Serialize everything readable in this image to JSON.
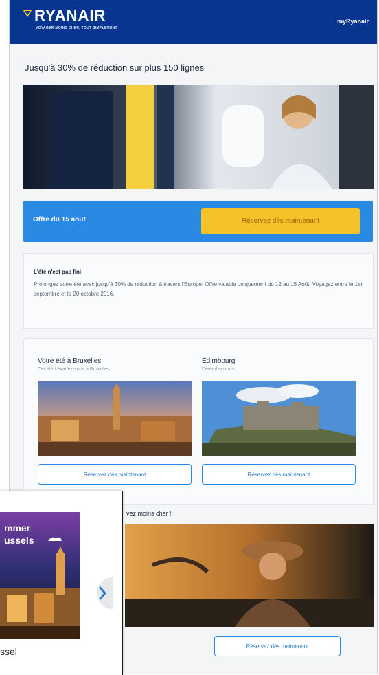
{
  "header": {
    "brand": "RYANAIR",
    "tagline": "VOYAGER MOINS CHER, TOUT SIMPLEMENT",
    "account_link": "myRyanair"
  },
  "main": {
    "headline": "Jusqu'à 30% de réduction sur plus 150 lignes",
    "promo": {
      "label": "Offre du 15 aout",
      "button": "Réservez dès maintenant"
    },
    "info": {
      "title": "L'été n'est pas fini",
      "body": "Prolongez votre été avec jusqu'à 30% de réduction à travers l'Europe. Offre valable uniquement du 12 au 15 Août. Voyagez entre le 1er septembre et le 20 octobre 2016."
    },
    "destinations": [
      {
        "title": "Votre été à Bruxelles",
        "subtitle": "Cet été ! évadez-vous à Bruxelles",
        "button": "Réservez dès maintenant"
      },
      {
        "title": "Édimbourg",
        "subtitle": "Détendez-vous",
        "button": "Réservez dès maintenant"
      }
    ],
    "cheaper_heading": "vez moins cher !",
    "bottom_button": "Réservez dès maintenant"
  },
  "overlay": {
    "image_caption_lines": [
      "mmer",
      "ussels"
    ],
    "text": "ssel",
    "next_icon": "chevron-right-icon"
  },
  "colors": {
    "brand_blue": "#073590",
    "accent_blue": "#2a8ae3",
    "accent_yellow": "#f5c229"
  }
}
